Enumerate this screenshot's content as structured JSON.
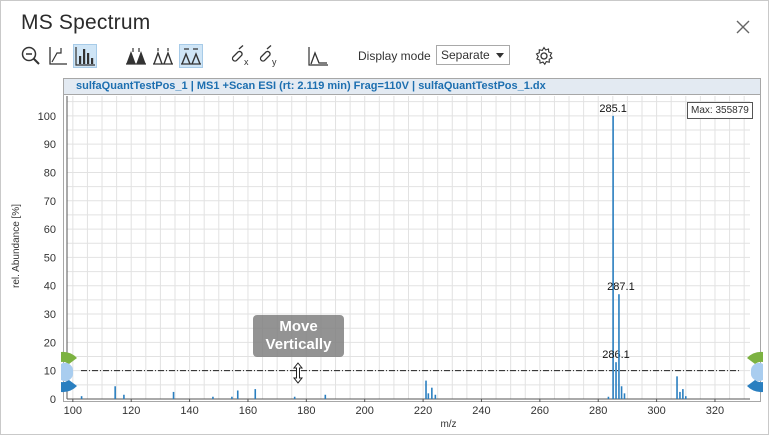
{
  "window": {
    "title": "MS Spectrum",
    "close_icon": "close-icon"
  },
  "toolbar": {
    "buttons": [
      {
        "name": "zoom-out-icon"
      },
      {
        "name": "autoscale-icon"
      },
      {
        "name": "bar-spectrum-icon",
        "active": true
      },
      {
        "name": "peak-labels-icon"
      },
      {
        "name": "peak-labels-alt-icon"
      },
      {
        "name": "peak-labels-toggle-icon",
        "active": true
      },
      {
        "name": "unlink-x-icon"
      },
      {
        "name": "unlink-y-icon"
      },
      {
        "name": "line-spectrum-icon"
      },
      {
        "name": "settings-gear-icon"
      }
    ],
    "display_mode_label": "Display mode",
    "display_mode_value": "Separate"
  },
  "panel": {
    "header": "sulfaQuantTestPos_1 | MS1 +Scan ESI (rt: 2.119 min) Frag=110V | sulfaQuantTestPos_1.dx",
    "max_label": "Max: 355879"
  },
  "overlay": {
    "tooltip": "Move Vertically"
  },
  "chart_data": {
    "type": "bar",
    "xlabel": "m/z",
    "ylabel": "rel. Abundance [%]",
    "xlim": [
      98,
      332
    ],
    "ylim": [
      0,
      107
    ],
    "xticks": [
      100,
      120,
      140,
      160,
      180,
      200,
      220,
      240,
      260,
      280,
      300,
      320
    ],
    "yticks": [
      0,
      10,
      20,
      30,
      40,
      50,
      60,
      70,
      80,
      90,
      100
    ],
    "grid": true,
    "threshold_line": 10,
    "color": "#2a7fc0",
    "peaks": [
      {
        "x": 103.0,
        "y": 1.0
      },
      {
        "x": 114.5,
        "y": 4.5
      },
      {
        "x": 117.5,
        "y": 1.5
      },
      {
        "x": 134.5,
        "y": 2.5
      },
      {
        "x": 148.0,
        "y": 0.8
      },
      {
        "x": 154.5,
        "y": 0.8
      },
      {
        "x": 156.5,
        "y": 3.0
      },
      {
        "x": 162.5,
        "y": 3.5
      },
      {
        "x": 176.0,
        "y": 0.8
      },
      {
        "x": 186.5,
        "y": 1.5
      },
      {
        "x": 221.0,
        "y": 6.5
      },
      {
        "x": 221.8,
        "y": 2.0
      },
      {
        "x": 223.0,
        "y": 4.0
      },
      {
        "x": 224.2,
        "y": 1.5
      },
      {
        "x": 283.5,
        "y": 0.8
      },
      {
        "x": 285.1,
        "y": 100,
        "label": "285.1"
      },
      {
        "x": 286.1,
        "y": 13,
        "label": "286.1"
      },
      {
        "x": 287.1,
        "y": 37,
        "label": "287.1"
      },
      {
        "x": 288.0,
        "y": 4.5
      },
      {
        "x": 289.0,
        "y": 2.0
      },
      {
        "x": 307.0,
        "y": 8.0
      },
      {
        "x": 308.0,
        "y": 2.5
      },
      {
        "x": 309.0,
        "y": 3.5
      },
      {
        "x": 310.0,
        "y": 1.0
      }
    ]
  }
}
